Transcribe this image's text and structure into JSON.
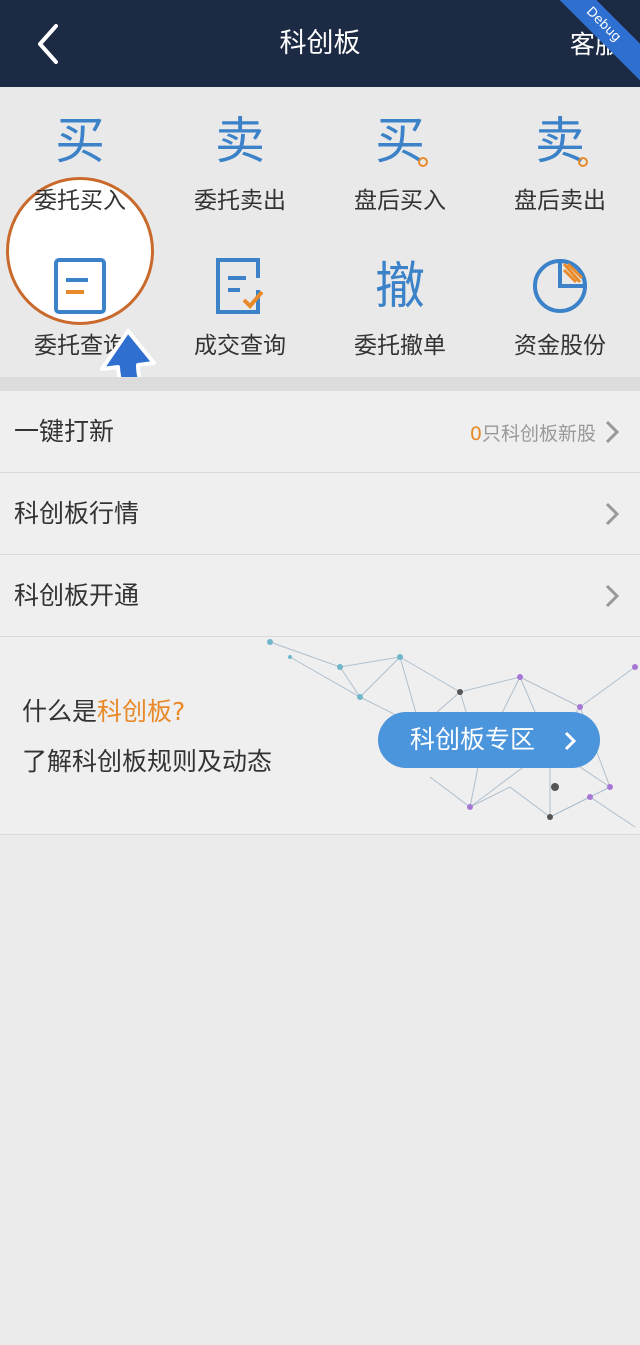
{
  "header": {
    "title": "科创板",
    "service_label": "客服",
    "debug_label": "Debug"
  },
  "grid": {
    "items": [
      {
        "icon_text": "买",
        "label": "委托买入"
      },
      {
        "icon_text": "卖",
        "label": "委托卖出"
      },
      {
        "icon_text": "买",
        "label": "盘后买入"
      },
      {
        "icon_text": "卖",
        "label": "盘后卖出"
      },
      {
        "icon_text": "",
        "label": "委托查询"
      },
      {
        "icon_text": "",
        "label": "成交查询"
      },
      {
        "icon_text": "撤",
        "label": "委托撤单"
      },
      {
        "icon_text": "",
        "label": "资金股份"
      }
    ]
  },
  "list": {
    "ipo": {
      "label": "一键打新",
      "count": "0",
      "suffix": "只科创板新股"
    },
    "market": {
      "label": "科创板行情"
    },
    "open": {
      "label": "科创板开通"
    }
  },
  "banner": {
    "question_prefix": "什么是",
    "question_highlight": "科创板?",
    "subtitle": "了解科创板规则及动态",
    "button_label": "科创板专区"
  },
  "colors": {
    "header_bg": "#1d2a44",
    "accent_blue": "#3b82c9",
    "accent_orange": "#e88a2a",
    "button_blue": "#4b95dc"
  }
}
